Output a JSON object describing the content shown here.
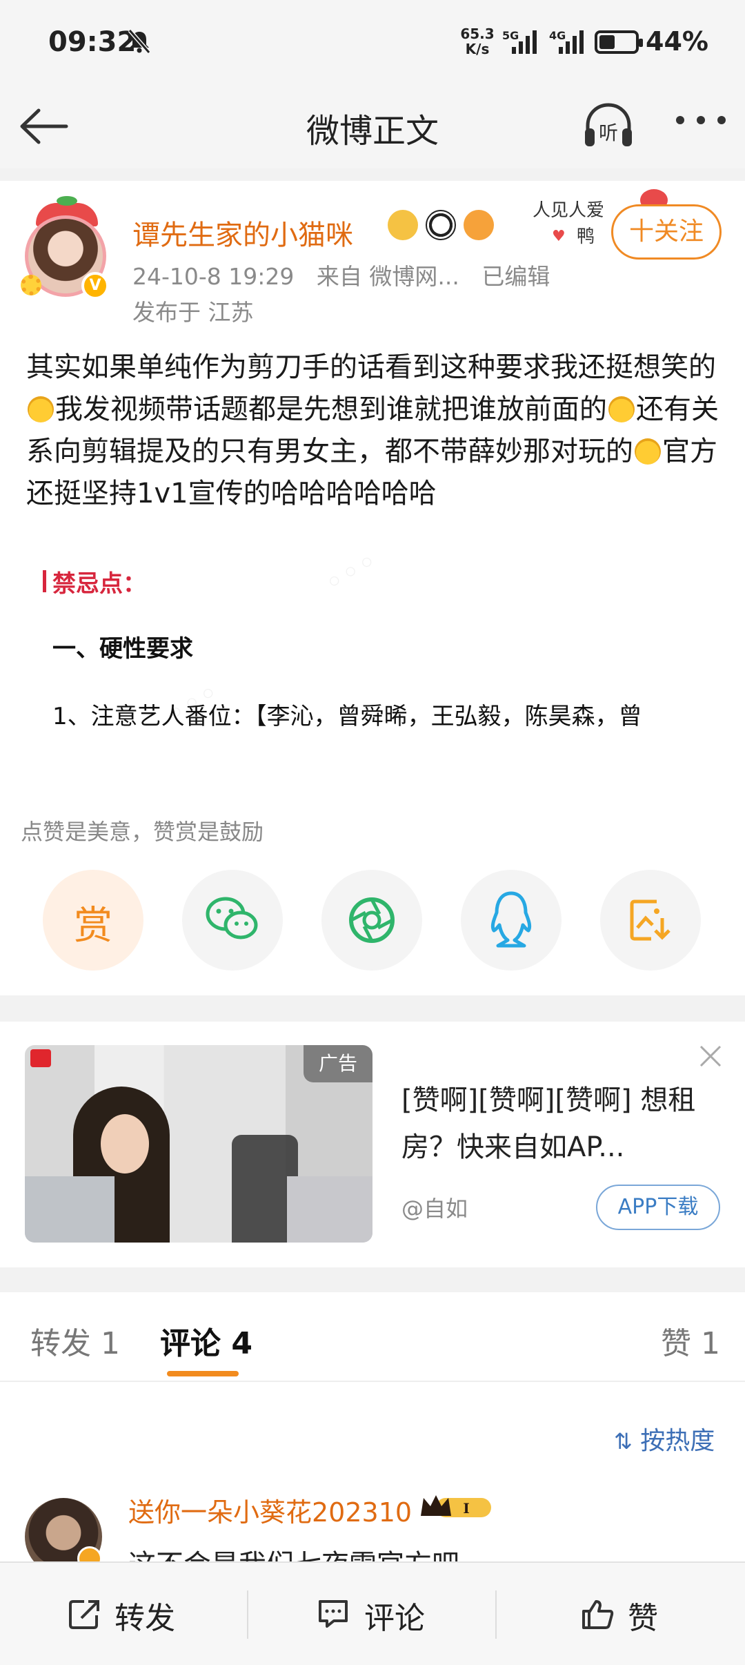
{
  "status_bar": {
    "time": "09:32",
    "net_speed_value": "65.3",
    "net_speed_unit": "K/s",
    "network_1": "5G",
    "network_2": "4G",
    "battery_percent": "44%",
    "battery_level": 0.44
  },
  "nav": {
    "title": "微博正文",
    "listen_label": "听"
  },
  "post": {
    "username": "谭先生家的小猫咪",
    "date": "24-10-8 19:29",
    "source": "来自 微博网...",
    "edited": "已编辑",
    "location": "发布于 江苏",
    "follow_label": "十关注",
    "sticker_line1": "人见人爱",
    "sticker_line2": "鸭",
    "text_1": "其实如果单纯作为剪刀手的话看到这种要求我还挺想笑的",
    "text_2": "我发视频带话题都是先想到谁就把谁放前面的",
    "text_3": "还有关系向剪辑提及的只有男女主，都不带薛妙那对玩的",
    "text_4": "官方还挺坚持1v1宣传的哈哈哈哈哈哈",
    "rules": {
      "heading": "禁忌点：",
      "subheading": "一、硬性要求",
      "line1": "1、注意艺人番位：【李沁，曾舜晞，王弘毅，陈昊森，曾"
    },
    "reward_tip": "点赞是美意，赞赏是鼓励",
    "reward_label": "赏"
  },
  "share_icons": [
    "reward-icon",
    "wechat-icon",
    "moments-icon",
    "qq-icon",
    "save-image-icon"
  ],
  "ad": {
    "badge": "广告",
    "title": "[赞啊][赞啊][赞啊] 想租房？快来自如AP...",
    "source": "@自如",
    "button": "APP下载"
  },
  "tabs": {
    "repost": "转发 1",
    "comment": "评论 4",
    "like": "赞 1"
  },
  "comments": {
    "sort_label": "按热度",
    "first": {
      "name": "送你一朵小葵花202310",
      "text": "这不会是我们七夜雪官方吧"
    }
  },
  "bottom_bar": {
    "repost": "转发",
    "comment": "评论",
    "like": "赞"
  },
  "colors": {
    "accent": "#f28b1e",
    "username": "#e06b12",
    "link": "#3d6fb6"
  }
}
